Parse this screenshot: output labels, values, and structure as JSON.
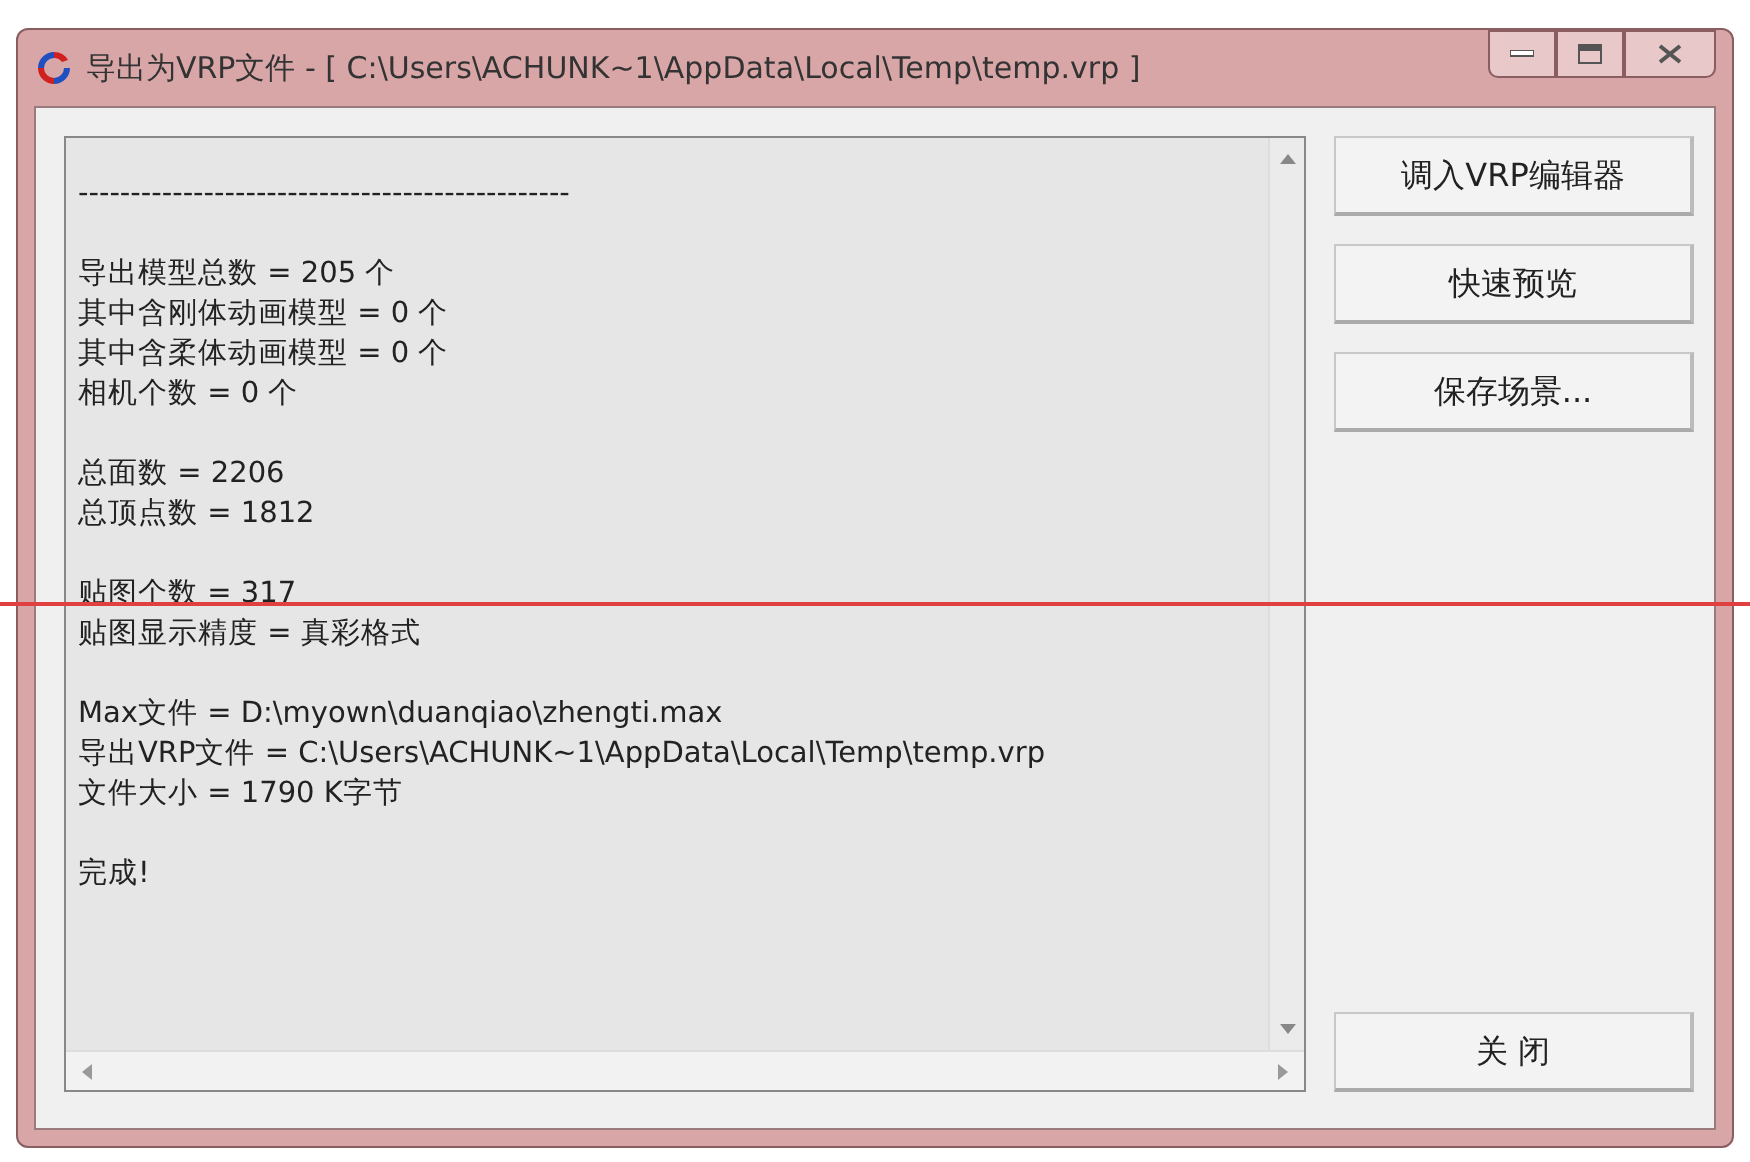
{
  "window": {
    "title": "导出为VRP文件 - [ C:\\Users\\ACHUNK~1\\AppData\\Local\\Temp\\temp.vrp ]"
  },
  "log_groups": [
    [
      "-----------------------------------------------"
    ],
    [
      "导出模型总数 = 205 个",
      "其中含刚体动画模型 = 0 个",
      "其中含柔体动画模型 = 0 个",
      "相机个数 = 0 个"
    ],
    [
      "总面数 = 2206",
      "总顶点数 = 1812"
    ],
    [
      "贴图个数 = 317",
      "贴图显示精度 = 真彩格式"
    ],
    [
      "Max文件 = D:\\myown\\duanqiao\\zhengti.max",
      "导出VRP文件 = C:\\Users\\ACHUNK~1\\AppData\\Local\\Temp\\temp.vrp",
      "文件大小 = 1790 K字节"
    ],
    [
      "完成!"
    ]
  ],
  "buttons": [
    {
      "label": "调入VRP编辑器",
      "kind": "top"
    },
    {
      "label": "快速预览",
      "kind": "top"
    },
    {
      "label": "保存场景...",
      "kind": "top"
    },
    {
      "label": "关 闭",
      "kind": "bottom"
    }
  ]
}
